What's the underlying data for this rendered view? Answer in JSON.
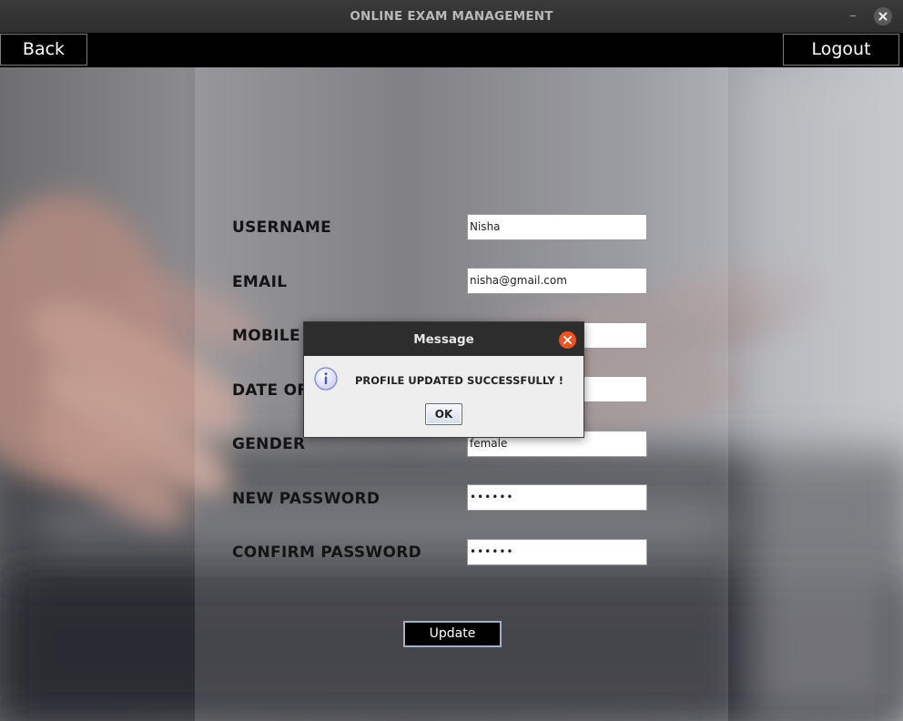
{
  "window": {
    "title": "ONLINE EXAM MANAGEMENT",
    "minimize_glyph": "–"
  },
  "toolbar": {
    "back_label": "Back",
    "logout_label": "Logout"
  },
  "form": {
    "fields": [
      {
        "label": "USERNAME",
        "value": "Nisha"
      },
      {
        "label": "EMAIL",
        "value": "nisha@gmail.com"
      },
      {
        "label": "MOBILE",
        "value": ""
      },
      {
        "label": "DATE OF",
        "value": ""
      },
      {
        "label": "GENDER",
        "value": "female"
      },
      {
        "label": "NEW PASSWORD",
        "value": "••••••"
      },
      {
        "label": "CONFIRM PASSWORD",
        "value": "••••••"
      }
    ],
    "update_label": "Update"
  },
  "dialog": {
    "title": "Message",
    "message": "PROFILE UPDATED SUCCESSFULLY !",
    "ok_label": "OK",
    "icon": "info-icon"
  },
  "colors": {
    "titlebar": "#2e2e2e",
    "toolbar": "#000000",
    "dialog_close": "#e95420",
    "info_icon": "#7c86d8"
  }
}
